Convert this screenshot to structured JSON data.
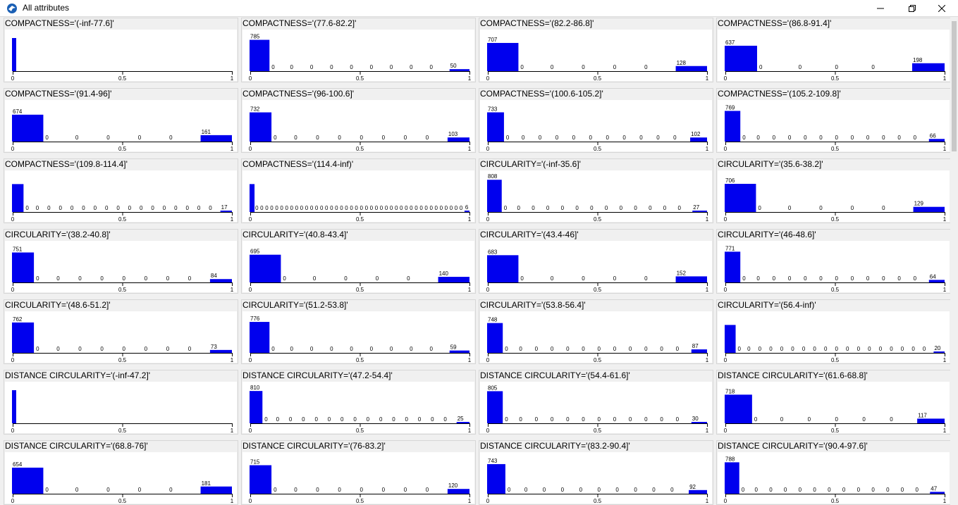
{
  "window": {
    "title": "All attributes"
  },
  "icons": {
    "app": "weka-bird-icon",
    "minimize": "minimize-icon",
    "maximize": "maximize-icon",
    "close": "close-icon"
  },
  "colors": {
    "bar": "#0000ee"
  },
  "chart_data": [
    {
      "type": "bar",
      "title": "COMPACTNESS='(-inf-77.6]'",
      "values": [],
      "labels": []
    },
    {
      "type": "bar",
      "title": "COMPACTNESS='(77.6-82.2]'",
      "values": [
        785,
        0,
        0,
        0,
        0,
        0,
        0,
        0,
        0,
        0,
        50
      ],
      "labels": [
        "785",
        "0",
        "0",
        "0",
        "0",
        "0",
        "0",
        "0",
        "0",
        "0",
        "50"
      ]
    },
    {
      "type": "bar",
      "title": "COMPACTNESS='(82.2-86.8]'",
      "values": [
        707,
        0,
        0,
        0,
        0,
        0,
        128
      ],
      "labels": [
        "707",
        "0",
        "0",
        "0",
        "0",
        "0",
        "128"
      ]
    },
    {
      "type": "bar",
      "title": "COMPACTNESS='(86.8-91.4]'",
      "values": [
        637,
        0,
        0,
        0,
        0,
        198
      ],
      "labels": [
        "637",
        "0",
        "0",
        "0",
        "0",
        "198"
      ]
    },
    {
      "type": "bar",
      "title": "COMPACTNESS='(91.4-96]'",
      "values": [
        674,
        0,
        0,
        0,
        0,
        0,
        161
      ],
      "labels": [
        "674",
        "0",
        "0",
        "0",
        "0",
        "0",
        "161"
      ]
    },
    {
      "type": "bar",
      "title": "COMPACTNESS='(96-100.6]'",
      "values": [
        732,
        0,
        0,
        0,
        0,
        0,
        0,
        0,
        0,
        103
      ],
      "labels": [
        "732",
        "0",
        "0",
        "0",
        "0",
        "0",
        "0",
        "0",
        "0",
        "103"
      ]
    },
    {
      "type": "bar",
      "title": "COMPACTNESS='(100.6-105.2]'",
      "values": [
        733,
        0,
        0,
        0,
        0,
        0,
        0,
        0,
        0,
        0,
        0,
        0,
        102
      ],
      "labels": [
        "733",
        "0",
        "0",
        "0",
        "0",
        "0",
        "0",
        "0",
        "0",
        "0",
        "0",
        "0",
        "102"
      ]
    },
    {
      "type": "bar",
      "title": "COMPACTNESS='(105.2-109.8]'",
      "values": [
        769,
        0,
        0,
        0,
        0,
        0,
        0,
        0,
        0,
        0,
        0,
        0,
        0,
        66
      ],
      "labels": [
        "769",
        "0",
        "0",
        "0",
        "0",
        "0",
        "0",
        "0",
        "0",
        "0",
        "0",
        "0",
        "0",
        "66"
      ]
    },
    {
      "type": "bar",
      "title": "COMPACTNESS='(109.8-114.4]'",
      "values": [
        700,
        0,
        0,
        0,
        0,
        0,
        0,
        0,
        0,
        0,
        0,
        0,
        0,
        0,
        0,
        0,
        0,
        0,
        17
      ],
      "labels": [
        "",
        "0",
        "0",
        "0",
        "0",
        "0",
        "0",
        "0",
        "0",
        "0",
        "0",
        "0",
        "0",
        "0",
        "0",
        "0",
        "0",
        "0",
        "17"
      ]
    },
    {
      "type": "bar",
      "title": "COMPACTNESS='(114.4-inf)'",
      "values": [
        700,
        0,
        0,
        0,
        0,
        0,
        0,
        0,
        0,
        0,
        0,
        0,
        0,
        0,
        0,
        0,
        0,
        0,
        0,
        0,
        0,
        0,
        0,
        0,
        0,
        0,
        0,
        0,
        0,
        0,
        0,
        0,
        0,
        0,
        0,
        0,
        0,
        0,
        0,
        0,
        0,
        0,
        0,
        6
      ],
      "labels": [
        "",
        "0",
        "0",
        "0",
        "0",
        "0",
        "0",
        "0",
        "0",
        "0",
        "0",
        "0",
        "0",
        "0",
        "0",
        "0",
        "0",
        "0",
        "0",
        "0",
        "0",
        "0",
        "0",
        "0",
        "0",
        "0",
        "0",
        "0",
        "0",
        "0",
        "0",
        "0",
        "0",
        "0",
        "0",
        "0",
        "0",
        "0",
        "0",
        "0",
        "0",
        "0",
        "0",
        "6"
      ]
    },
    {
      "type": "bar",
      "title": "CIRCULARITY='(-inf-35.6]'",
      "values": [
        808,
        0,
        0,
        0,
        0,
        0,
        0,
        0,
        0,
        0,
        0,
        0,
        0,
        0,
        27
      ],
      "labels": [
        "808",
        "0",
        "0",
        "0",
        "0",
        "0",
        "0",
        "0",
        "0",
        "0",
        "0",
        "0",
        "0",
        "0",
        "27"
      ]
    },
    {
      "type": "bar",
      "title": "CIRCULARITY='(35.6-38.2]'",
      "values": [
        706,
        0,
        0,
        0,
        0,
        0,
        129
      ],
      "labels": [
        "706",
        "0",
        "0",
        "0",
        "0",
        "0",
        "129"
      ]
    },
    {
      "type": "bar",
      "title": "CIRCULARITY='(38.2-40.8]'",
      "values": [
        751,
        0,
        0,
        0,
        0,
        0,
        0,
        0,
        0,
        84
      ],
      "labels": [
        "751",
        "0",
        "0",
        "0",
        "0",
        "0",
        "0",
        "0",
        "0",
        "84"
      ]
    },
    {
      "type": "bar",
      "title": "CIRCULARITY='(40.8-43.4]'",
      "values": [
        695,
        0,
        0,
        0,
        0,
        0,
        140
      ],
      "labels": [
        "695",
        "0",
        "0",
        "0",
        "0",
        "0",
        "140"
      ]
    },
    {
      "type": "bar",
      "title": "CIRCULARITY='(43.4-46]'",
      "values": [
        683,
        0,
        0,
        0,
        0,
        0,
        152
      ],
      "labels": [
        "683",
        "0",
        "0",
        "0",
        "0",
        "0",
        "152"
      ]
    },
    {
      "type": "bar",
      "title": "CIRCULARITY='(46-48.6]'",
      "values": [
        771,
        0,
        0,
        0,
        0,
        0,
        0,
        0,
        0,
        0,
        0,
        0,
        0,
        64
      ],
      "labels": [
        "771",
        "0",
        "0",
        "0",
        "0",
        "0",
        "0",
        "0",
        "0",
        "0",
        "0",
        "0",
        "0",
        "64"
      ]
    },
    {
      "type": "bar",
      "title": "CIRCULARITY='(48.6-51.2]'",
      "values": [
        762,
        0,
        0,
        0,
        0,
        0,
        0,
        0,
        0,
        73
      ],
      "labels": [
        "762",
        "0",
        "0",
        "0",
        "0",
        "0",
        "0",
        "0",
        "0",
        "73"
      ]
    },
    {
      "type": "bar",
      "title": "CIRCULARITY='(51.2-53.8]'",
      "values": [
        776,
        0,
        0,
        0,
        0,
        0,
        0,
        0,
        0,
        0,
        59
      ],
      "labels": [
        "776",
        "0",
        "0",
        "0",
        "0",
        "0",
        "0",
        "0",
        "0",
        "0",
        "59"
      ]
    },
    {
      "type": "bar",
      "title": "CIRCULARITY='(53.8-56.4]'",
      "values": [
        748,
        0,
        0,
        0,
        0,
        0,
        0,
        0,
        0,
        0,
        0,
        0,
        0,
        87
      ],
      "labels": [
        "748",
        "0",
        "0",
        "0",
        "0",
        "0",
        "0",
        "0",
        "0",
        "0",
        "0",
        "0",
        "0",
        "87"
      ]
    },
    {
      "type": "bar",
      "title": "CIRCULARITY='(56.4-inf)'",
      "values": [
        700,
        0,
        0,
        0,
        0,
        0,
        0,
        0,
        0,
        0,
        0,
        0,
        0,
        0,
        0,
        0,
        0,
        0,
        0,
        20
      ],
      "labels": [
        "",
        "0",
        "0",
        "0",
        "0",
        "0",
        "0",
        "0",
        "0",
        "0",
        "0",
        "0",
        "0",
        "0",
        "0",
        "0",
        "0",
        "0",
        "0",
        "20"
      ]
    },
    {
      "type": "bar",
      "title": "DISTANCE CIRCULARITY='(-inf-47.2]'",
      "values": [],
      "labels": []
    },
    {
      "type": "bar",
      "title": "DISTANCE CIRCULARITY='(47.2-54.4]'",
      "values": [
        810,
        0,
        0,
        0,
        0,
        0,
        0,
        0,
        0,
        0,
        0,
        0,
        0,
        0,
        0,
        0,
        25
      ],
      "labels": [
        "810",
        "0",
        "0",
        "0",
        "0",
        "0",
        "0",
        "0",
        "0",
        "0",
        "0",
        "0",
        "0",
        "0",
        "0",
        "0",
        "25"
      ]
    },
    {
      "type": "bar",
      "title": "DISTANCE CIRCULARITY='(54.4-61.6]'",
      "values": [
        805,
        0,
        0,
        0,
        0,
        0,
        0,
        0,
        0,
        0,
        0,
        0,
        0,
        30
      ],
      "labels": [
        "805",
        "0",
        "0",
        "0",
        "0",
        "0",
        "0",
        "0",
        "0",
        "0",
        "0",
        "0",
        "0",
        "30"
      ]
    },
    {
      "type": "bar",
      "title": "DISTANCE CIRCULARITY='(61.6-68.8]'",
      "values": [
        718,
        0,
        0,
        0,
        0,
        0,
        0,
        117
      ],
      "labels": [
        "718",
        "0",
        "0",
        "0",
        "0",
        "0",
        "0",
        "117"
      ]
    },
    {
      "type": "bar",
      "title": "DISTANCE CIRCULARITY='(68.8-76]'",
      "values": [
        654,
        0,
        0,
        0,
        0,
        0,
        181
      ],
      "labels": [
        "654",
        "0",
        "0",
        "0",
        "0",
        "0",
        "181"
      ]
    },
    {
      "type": "bar",
      "title": "DISTANCE CIRCULARITY='(76-83.2]'",
      "values": [
        715,
        0,
        0,
        0,
        0,
        0,
        0,
        0,
        0,
        120
      ],
      "labels": [
        "715",
        "0",
        "0",
        "0",
        "0",
        "0",
        "0",
        "0",
        "0",
        "120"
      ]
    },
    {
      "type": "bar",
      "title": "DISTANCE CIRCULARITY='(83.2-90.4]'",
      "values": [
        743,
        0,
        0,
        0,
        0,
        0,
        0,
        0,
        0,
        0,
        0,
        92
      ],
      "labels": [
        "743",
        "0",
        "0",
        "0",
        "0",
        "0",
        "0",
        "0",
        "0",
        "0",
        "0",
        "92"
      ]
    },
    {
      "type": "bar",
      "title": "DISTANCE CIRCULARITY='(90.4-97.6]'",
      "values": [
        788,
        0,
        0,
        0,
        0,
        0,
        0,
        0,
        0,
        0,
        0,
        0,
        0,
        0,
        47
      ],
      "labels": [
        "788",
        "0",
        "0",
        "0",
        "0",
        "0",
        "0",
        "0",
        "0",
        "0",
        "0",
        "0",
        "0",
        "0",
        "47"
      ]
    }
  ],
  "axis_ticks": [
    "0",
    "0.5",
    "1"
  ]
}
